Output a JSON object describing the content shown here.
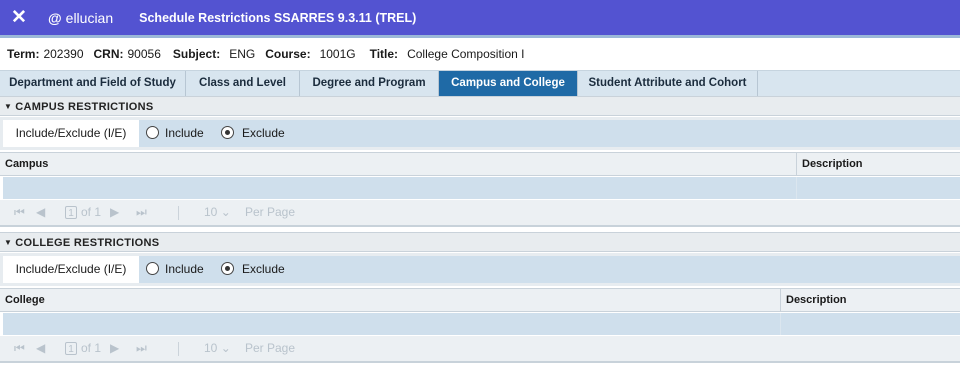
{
  "header": {
    "close_glyph": "✕",
    "brand_mark": "@",
    "brand_name": "ellucian",
    "app_title": "Schedule Restrictions SSARRES 9.3.11 (TREL)"
  },
  "key_block": {
    "term_label": "Term:",
    "term_value": "202390",
    "crn_label": "CRN:",
    "crn_value": "90056",
    "subject_label": "Subject:",
    "subject_value": "ENG",
    "course_label": "Course:",
    "course_value": "1001G",
    "title_label": "Title:",
    "title_value": "College Composition I"
  },
  "tabs": [
    {
      "label": "Department and Field of Study"
    },
    {
      "label": "Class and Level"
    },
    {
      "label": "Degree and Program"
    },
    {
      "label": "Campus and College",
      "active": true
    },
    {
      "label": "Student Attribute and Cohort"
    }
  ],
  "campus": {
    "section_title": "CAMPUS RESTRICTIONS",
    "ie_label": "Include/Exclude (I/E)",
    "include_label": "Include",
    "exclude_label": "Exclude",
    "selected": "Exclude",
    "col_main": "Campus",
    "col_desc": "Description",
    "pager": {
      "page": "1",
      "of_label": "of 1",
      "per_page_value": "10",
      "per_page_label": "Per Page"
    }
  },
  "college": {
    "section_title": "COLLEGE RESTRICTIONS",
    "ie_label": "Include/Exclude (I/E)",
    "include_label": "Include",
    "exclude_label": "Exclude",
    "selected": "Exclude",
    "col_main": "College",
    "col_desc": "Description",
    "pager": {
      "page": "1",
      "of_label": "of 1",
      "per_page_value": "10",
      "per_page_label": "Per Page"
    }
  },
  "colors": {
    "header_bg": "#5353d1",
    "active_tab": "#1f6aa6",
    "row_bg": "#cfdfec"
  }
}
